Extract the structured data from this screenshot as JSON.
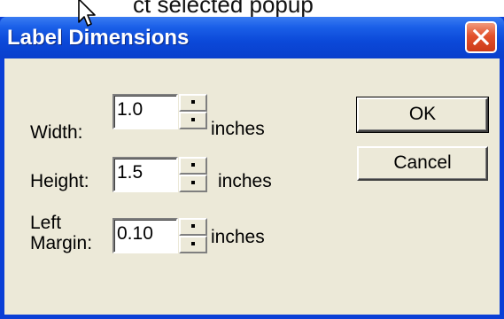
{
  "background_text": "ct selected popup",
  "dialog": {
    "title": "Label Dimensions",
    "fields": [
      {
        "label": "Width:",
        "value": "1.0",
        "unit": "inches"
      },
      {
        "label": "Height:",
        "value": "1.5",
        "unit": "inches"
      },
      {
        "label_line1": "Left",
        "label_line2": "Margin:",
        "value": "0.10",
        "unit": "inches"
      }
    ],
    "buttons": {
      "ok": "OK",
      "cancel": "Cancel"
    }
  },
  "colors": {
    "titlebar": "#0a48d8",
    "client": "#ece9d8",
    "close": "#e2512c"
  }
}
